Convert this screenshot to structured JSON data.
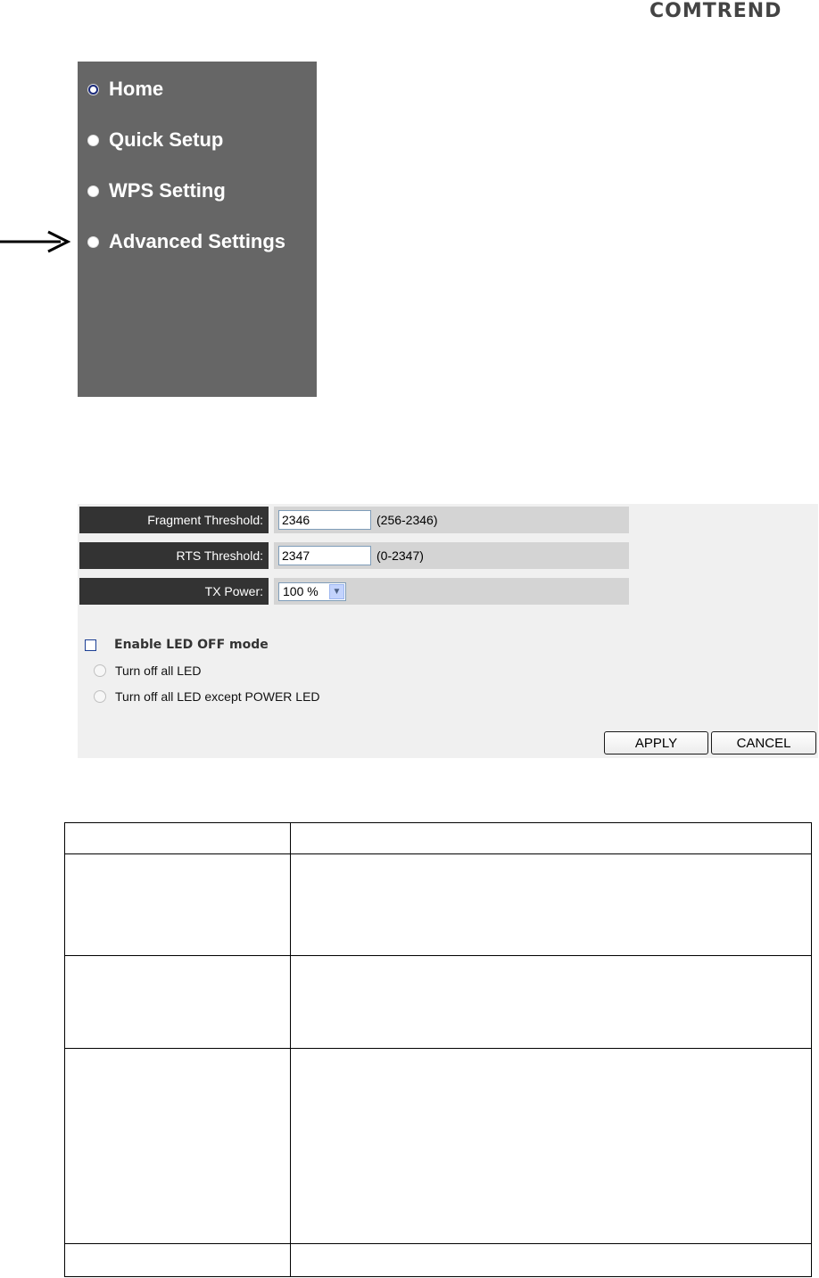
{
  "logo": {
    "text": "COMTREND"
  },
  "menu": {
    "items": [
      {
        "label": "Home"
      },
      {
        "label": "Quick Setup"
      },
      {
        "label": "WPS Setting"
      },
      {
        "label": "Advanced Settings"
      }
    ]
  },
  "settings": {
    "fragment": {
      "label": "Fragment Threshold:",
      "value": "2346",
      "hint": "(256-2346)"
    },
    "rts": {
      "label": "RTS Threshold:",
      "value": "2347",
      "hint": "(0-2347)"
    },
    "tx": {
      "label": "TX Power:",
      "value": "100 %"
    },
    "led": {
      "checkbox_label": "Enable LED OFF mode",
      "radio1": "Turn off all LED",
      "radio2": "Turn off all LED except POWER LED"
    },
    "apply_label": "APPLY",
    "cancel_label": "CANCEL"
  },
  "colors": {
    "menu_bg": "#666666",
    "label_bg": "#333333",
    "value_bg": "#d4d4d4",
    "panel_bg": "#f0f0f0"
  }
}
